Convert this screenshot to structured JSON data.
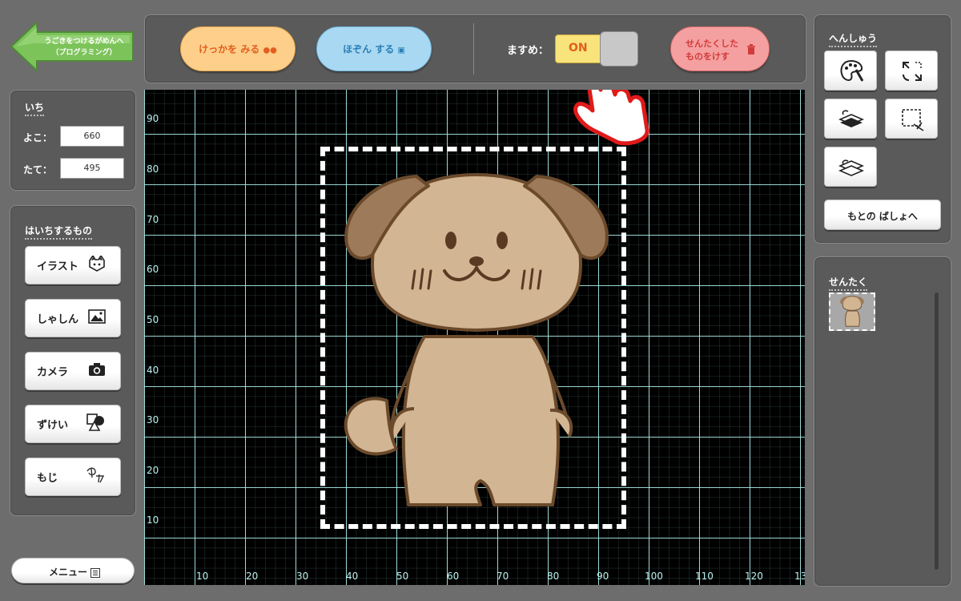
{
  "back_button": {
    "line1": "うごきをつけるがめんへ",
    "line2": "（プログラミング）"
  },
  "top_bar": {
    "result_label": "けっかを みる",
    "save_label": "ほぞん する",
    "snap_label": "ますめ：",
    "snap_state": "ON",
    "delete_line1": "せんたくした",
    "delete_line2": "ものをけす"
  },
  "position_panel": {
    "title": "いち",
    "x_label": "よこ：",
    "x_value": "660",
    "y_label": "たて：",
    "y_value": "495"
  },
  "place_panel": {
    "title": "はいちするもの",
    "items": [
      {
        "label": "イラスト",
        "icon": "cat-face-icon"
      },
      {
        "label": "しゃしん",
        "icon": "photo-icon"
      },
      {
        "label": "カメラ",
        "icon": "camera-icon"
      },
      {
        "label": "ずけい",
        "icon": "shapes-icon"
      },
      {
        "label": "もじ",
        "icon": "text-icon"
      }
    ]
  },
  "menu_button": {
    "label": "メニュー"
  },
  "edit_panel": {
    "title": "へんしゅう",
    "tools": [
      "palette-icon",
      "resize-icon",
      "bring-forward-icon",
      "crop-icon",
      "send-backward-icon"
    ],
    "reset_label": "もとの ばしょへ"
  },
  "selection_panel": {
    "title": "せんたく"
  },
  "canvas": {
    "y_ticks": [
      "90",
      "80",
      "70",
      "60",
      "50",
      "40",
      "30",
      "20",
      "10"
    ],
    "x_ticks": [
      "10",
      "20",
      "30",
      "40",
      "50",
      "60",
      "70",
      "80",
      "90",
      "100",
      "110",
      "120",
      "13"
    ]
  },
  "colors": {
    "background": "#6d6d6d",
    "canvas": "#000000",
    "grid": "#aef2ee",
    "result_button": "#fdcf8a",
    "save_button": "#a9d8f2",
    "delete_button": "#f5a0a0",
    "snap_on": "#f8e47a",
    "dog_body": "#d2b593",
    "dog_ear": "#9c7a5a",
    "dog_outline": "#6b4a2c"
  }
}
